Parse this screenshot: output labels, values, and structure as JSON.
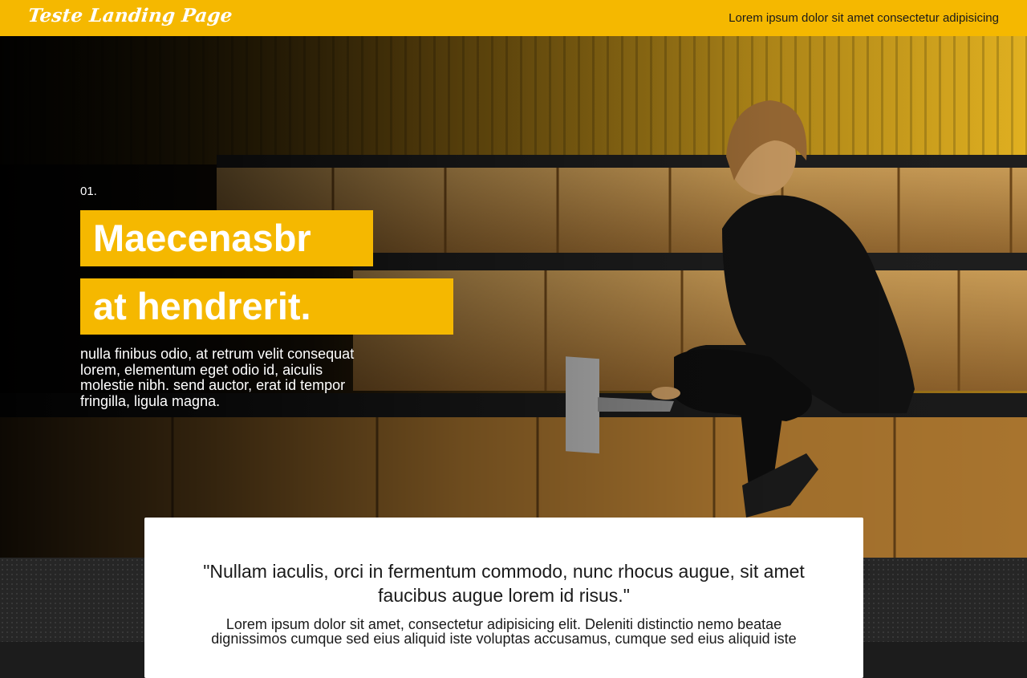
{
  "header": {
    "logo_text": "Teste Landing Page",
    "link_text": "Lorem ipsum dolor sit amet consectetur adipisicing"
  },
  "hero": {
    "number": "01.",
    "title_line1": "Maecenasbr",
    "title_line2": "at hendrerit.",
    "description": "nulla finibus odio, at retrum velit consequat lorem, elementum eget odio id, aiculis molestie nibh. send auctor, erat id tempor fringilla, ligula magna.",
    "image": "woman-with-laptop-on-wooden-benches-photo"
  },
  "testimonial": {
    "quote": "\"Nullam iaculis, orci in fermentum commodo, nunc rhocus augue, sit amet faucibus augue lorem id risus.\"",
    "text": "Lorem ipsum dolor sit amet, consectetur adipisicing elit. Deleniti distinctio nemo beatae dignissimos cumque sed eius aliquid iste voluptas accusamus, cumque sed eius aliquid iste"
  },
  "colors": {
    "accent": "#f5b800",
    "hero_dark": "#050505",
    "lower_bg": "#262626",
    "card_bg": "#ffffff"
  }
}
